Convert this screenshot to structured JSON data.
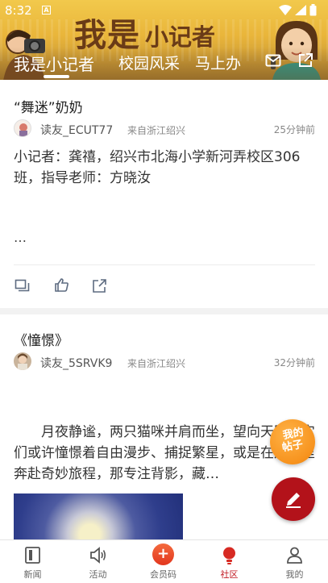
{
  "status_bar": {
    "time": "8:32",
    "app_badge": "A"
  },
  "banner": {
    "title_big": "我是",
    "title_small": "小记者"
  },
  "tabs": [
    {
      "label": "我是小记者",
      "active": true
    },
    {
      "label": "校园风采",
      "active": false
    },
    {
      "label": "马上办",
      "active": false
    }
  ],
  "header_icons": [
    "mail-icon",
    "share-icon"
  ],
  "posts": [
    {
      "title": "“舞迷”奶奶",
      "username": "读友_ECUT77",
      "location": "来自浙江绍兴",
      "time": "25分钟前",
      "body": "小记者：龚禧，绍兴市北海小学新河弄校区306班，指导老师：方晓汝",
      "ellipsis": "…",
      "actions": [
        "comment-icon",
        "like-icon",
        "share-icon"
      ]
    },
    {
      "title": "《憧憬》",
      "username": "读友_5SRVK9",
      "location": "来自浙江绍兴",
      "time": "32分钟前",
      "body": "月夜静谧，两只猫咪并肩而坐，望向天际。它们或许憧憬着自由漫步、捕捉繁星，或是在月光里奔赴奇妙旅程，那专注背影，藏…"
    }
  ],
  "floating": {
    "my_posts_line1": "我的",
    "my_posts_line2": "帖子"
  },
  "bottom_nav": [
    {
      "label": "新闻",
      "icon": "news-icon",
      "active": false
    },
    {
      "label": "活动",
      "icon": "speaker-icon",
      "active": false
    },
    {
      "label": "会员码",
      "icon": "plus-icon",
      "active": false
    },
    {
      "label": "社区",
      "icon": "lightbulb-icon",
      "active": true
    },
    {
      "label": "我的",
      "icon": "person-icon",
      "active": false
    }
  ],
  "colors": {
    "accent": "#c0161f",
    "fab_orange": "#f7931e",
    "fab_red": "#b3121a"
  }
}
